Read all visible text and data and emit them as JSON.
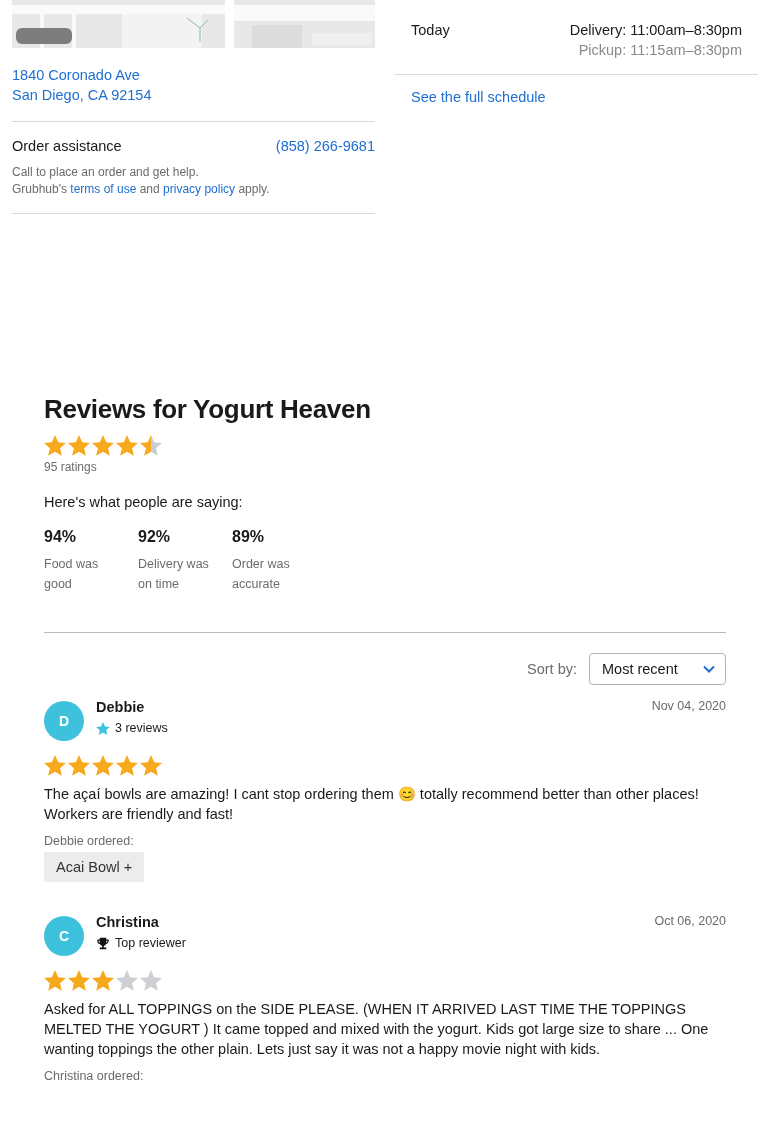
{
  "location": {
    "map": {
      "kind": "picture"
    },
    "address_lines": [
      "1840 Coronado Ave",
      "San Diego, CA 92154"
    ],
    "assistance": {
      "label": "Order assistance",
      "phone": "(858) 266-9681",
      "note": "Call to place an order and get help.",
      "legal": [
        "Grubhub's ",
        "terms of use",
        " and ",
        "privacy policy",
        " apply."
      ]
    }
  },
  "hours": {
    "day": "Today",
    "delivery": "Delivery: 11:00am–8:30pm",
    "pickup": "Pickup: 11:15am–8:30pm",
    "schedule_link": "See the full schedule"
  },
  "reviews": {
    "title": "Reviews for Yogurt Heaven",
    "stars": 4.5,
    "ratings": "95 ratings",
    "saying": "Here's what people are saying:",
    "stats": [
      {
        "percent": "94%",
        "label": "Food was good"
      },
      {
        "percent": "92%",
        "label": "Delivery was on time"
      },
      {
        "percent": "89%",
        "label": "Order was accurate"
      }
    ],
    "sort": {
      "label": "Sort by:",
      "value": "Most recent"
    },
    "items": [
      {
        "initial": "D",
        "name": "Debbie",
        "badge": {
          "kind": "reviews",
          "text": "3 reviews"
        },
        "date": "Nov 04, 2020",
        "stars": 5,
        "text": "The açaí bowls are amazing! I cant stop ordering them 😊 totally recommend better than other places! Workers are friendly and fast!",
        "ordered_label": "Debbie ordered:",
        "ordered": [
          "Acai Bowl +"
        ]
      },
      {
        "initial": "C",
        "name": "Christina",
        "badge": {
          "kind": "top",
          "text": "Top reviewer"
        },
        "date": "Oct 06, 2020",
        "stars": 3,
        "text": "Asked for ALL TOPPINGS on the SIDE PLEASE. (WHEN IT ARRIVED LAST TIME THE TOPPINGS MELTED THE YOGURT ) It came topped and mixed with the yogurt. Kids got large size to share ... One wanting toppings the other plain. Lets just say it was not a happy movie night with kids.",
        "ordered_label": "Christina ordered:"
      }
    ]
  }
}
